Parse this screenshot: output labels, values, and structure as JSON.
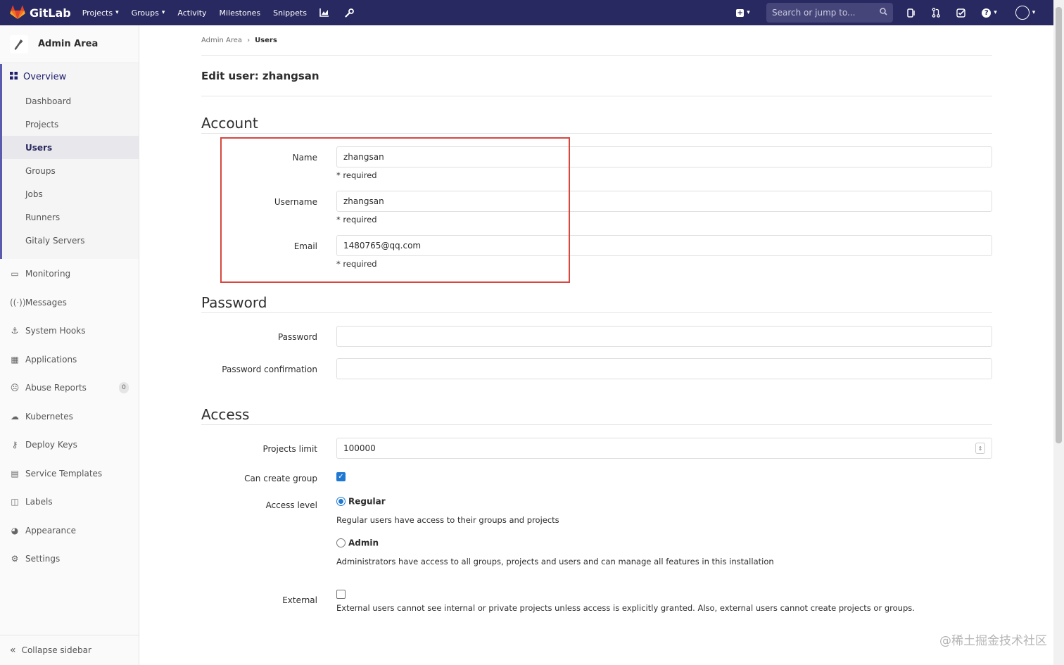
{
  "navbar": {
    "brand": "GitLab",
    "links": [
      "Projects",
      "Groups",
      "Activity",
      "Milestones",
      "Snippets"
    ],
    "search_placeholder": "Search or jump to..."
  },
  "sidebar": {
    "header": "Admin Area",
    "overview": "Overview",
    "sub_items": [
      "Dashboard",
      "Projects",
      "Users",
      "Groups",
      "Jobs",
      "Runners",
      "Gitaly Servers"
    ],
    "items": [
      "Monitoring",
      "Messages",
      "System Hooks",
      "Applications",
      "Abuse Reports",
      "Kubernetes",
      "Deploy Keys",
      "Service Templates",
      "Labels",
      "Appearance",
      "Settings"
    ],
    "abuse_count": "0",
    "collapse": "Collapse sidebar"
  },
  "breadcrumb": {
    "root": "Admin Area",
    "current": "Users"
  },
  "page": {
    "title": "Edit user: zhangsan",
    "account_title": "Account",
    "name_label": "Name",
    "name_value": "zhangsan",
    "username_label": "Username",
    "username_value": "zhangsan",
    "email_label": "Email",
    "email_value": "1480765@qq.com",
    "required": "* required",
    "password_title": "Password",
    "password_label": "Password",
    "password_confirm_label": "Password confirmation",
    "access_title": "Access",
    "projects_limit_label": "Projects limit",
    "projects_limit_value": "100000",
    "can_create_group_label": "Can create group",
    "access_level_label": "Access level",
    "regular_label": "Regular",
    "regular_help": "Regular users have access to their groups and projects",
    "admin_label": "Admin",
    "admin_help": "Administrators have access to all groups, projects and users and can manage all features in this installation",
    "external_label": "External",
    "external_help": "External users cannot see internal or private projects unless access is explicitly granted. Also, external users cannot create projects or groups."
  },
  "watermark": "@稀土掘金技术社区"
}
